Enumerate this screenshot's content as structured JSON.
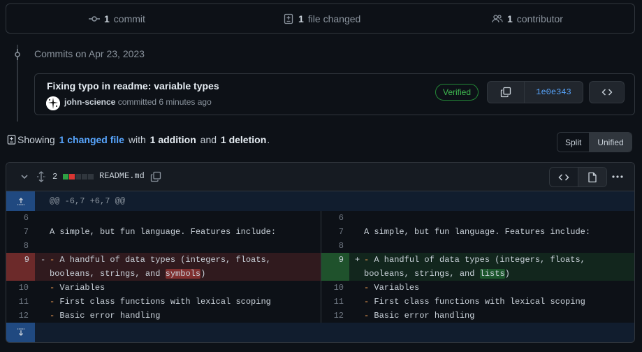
{
  "summary": {
    "commits_count": "1",
    "commits_label": "commit",
    "files_count": "1",
    "files_label": "file changed",
    "contributors_count": "1",
    "contributors_label": "contributor"
  },
  "timeline": {
    "date_label": "Commits on Apr 23, 2023"
  },
  "commit": {
    "title": "Fixing typo in readme: variable types",
    "author": "john-science",
    "action_text": "committed 6 minutes ago",
    "verified_label": "Verified",
    "sha": "1e0e343"
  },
  "showing": {
    "prefix": "Showing",
    "changed_files": "1 changed file",
    "with": "with",
    "additions": "1 addition",
    "and": "and",
    "deletions": "1 deletion",
    "suffix": "."
  },
  "view_toggle": {
    "split_label": "Split",
    "unified_label": "Unified",
    "selected": "Split"
  },
  "file": {
    "changes_count": "2",
    "filename": "README.md",
    "hunk_header": "@@ -6,7 +6,7 @@",
    "left": {
      "l6": {
        "num": "6",
        "text": ""
      },
      "l7": {
        "num": "7",
        "text": "A simple, but fun language. Features include:"
      },
      "l8": {
        "num": "8",
        "text": ""
      },
      "l9": {
        "num": "9",
        "sign": "-",
        "dash": "-",
        "text_a": " A handful of data types (integers, floats,",
        "text_b": "booleans, strings, and ",
        "word": "symbols",
        "text_c": ")"
      },
      "l10": {
        "num": "10",
        "dash": "-",
        "text": " Variables"
      },
      "l11": {
        "num": "11",
        "dash": "-",
        "text": " First class functions with lexical scoping"
      },
      "l12": {
        "num": "12",
        "dash": "-",
        "text": " Basic error handling"
      }
    },
    "right": {
      "l6": {
        "num": "6",
        "text": ""
      },
      "l7": {
        "num": "7",
        "text": "A simple, but fun language. Features include:"
      },
      "l8": {
        "num": "8",
        "text": ""
      },
      "l9": {
        "num": "9",
        "sign": "+",
        "dash": "-",
        "text_a": " A handful of data types (integers, floats,",
        "text_b": "booleans, strings, and ",
        "word": "lists",
        "text_c": ")"
      },
      "l10": {
        "num": "10",
        "dash": "-",
        "text": " Variables"
      },
      "l11": {
        "num": "11",
        "dash": "-",
        "text": " First class functions with lexical scoping"
      },
      "l12": {
        "num": "12",
        "dash": "-",
        "text": " Basic error handling"
      }
    }
  },
  "colors": {
    "background": "#0d1117",
    "border": "#30363d",
    "link": "#58a6ff",
    "verified": "#3fb950",
    "addition": "#2ea043",
    "deletion": "#f85149"
  }
}
